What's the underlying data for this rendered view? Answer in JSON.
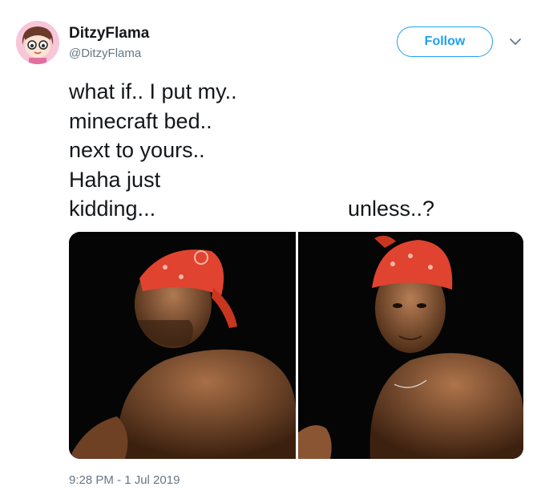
{
  "user": {
    "display_name": "DitzyFlama",
    "handle": "@DitzyFlama"
  },
  "follow_button": {
    "label": "Follow"
  },
  "more_icon": "chevron-down-icon",
  "tweet": {
    "text": "what if.. I put my..\nminecraft bed..\nnext to yours..\nHaha just\nkidding...",
    "text_right": "unless..?",
    "timestamp": "9:28 PM - 1 Jul 2019"
  },
  "colors": {
    "accent": "#1da1f2",
    "secondary_text": "#657786",
    "primary_text": "#14171a",
    "bandana": "#e0432f"
  }
}
